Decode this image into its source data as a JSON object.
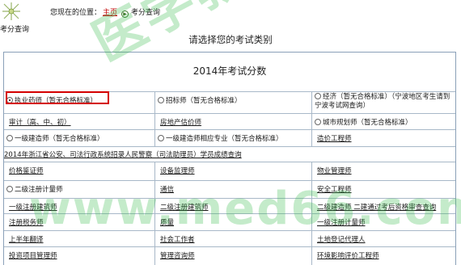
{
  "breadcrumb": {
    "prefix": "您现在的位置：",
    "home": "主页",
    "current": "考分查询"
  },
  "page": {
    "subtitle": "考分查询",
    "heading": "请选择您的考试类别",
    "year_title": "2014年考试分数"
  },
  "watermark": {
    "cn": "医学教育网",
    "url": "www.med66.com"
  },
  "rows": [
    {
      "cells": [
        {
          "label": "执业药师（暂无合格标准）",
          "type": "radio",
          "selected": true
        },
        {
          "label": "招标师（暂无合格标准）",
          "type": "radio",
          "selected": false
        },
        {
          "label": "经济（暂无合格标准）（宁波地区考生请到宁波考试网查询）",
          "type": "radio",
          "selected": false
        }
      ]
    },
    {
      "cells": [
        {
          "label": "审计（高、中、初）",
          "type": "link"
        },
        {
          "label": "房地产估价师",
          "type": "link"
        },
        {
          "label": "城市规划师（暂无合格标准）",
          "type": "radio",
          "selected": false
        }
      ]
    },
    {
      "cells": [
        {
          "label": "一级建造师（暂无合格标准）",
          "type": "radio",
          "selected": false
        },
        {
          "label": "一级建造师相应专业（暂无合格标准）",
          "type": "radio",
          "selected": false
        },
        {
          "label": "造价工程师",
          "type": "link"
        }
      ]
    },
    {
      "full": "2014年浙江省公安、司法行政系统招录人民警察（司法助理员）学员成绩查询"
    },
    {
      "cells": [
        {
          "label": "价格鉴证师",
          "type": "link"
        },
        {
          "label": "设备监理师",
          "type": "link"
        },
        {
          "label": "物业管理师",
          "type": "link"
        }
      ]
    },
    {
      "cells": [
        {
          "label": "二级注册计量师",
          "type": "radio",
          "selected": false
        },
        {
          "label": "通信",
          "type": "link"
        },
        {
          "label": "安全工程师",
          "type": "link"
        }
      ]
    },
    {
      "cells": [
        {
          "label": "一级注册建筑师",
          "type": "link"
        },
        {
          "label": "二级注册建筑师",
          "type": "link"
        },
        {
          "label": "二级建造师 二建通过考后资格审查查询",
          "type": "link"
        }
      ]
    },
    {
      "cells": [
        {
          "label": "注册税务师",
          "type": "link"
        },
        {
          "label": "质量",
          "type": "link"
        },
        {
          "label": "一级注册计量师",
          "type": "link"
        }
      ]
    },
    {
      "cells": [
        {
          "label": "上半年翻译",
          "type": "link"
        },
        {
          "label": "社会工作者",
          "type": "link"
        },
        {
          "label": "土地登记代理人",
          "type": "link"
        }
      ]
    },
    {
      "cells": [
        {
          "label": "投资项目管理师",
          "type": "link"
        },
        {
          "label": "管理咨询师",
          "type": "link"
        },
        {
          "label": "环境影响评价工程师",
          "type": "link"
        }
      ]
    }
  ]
}
